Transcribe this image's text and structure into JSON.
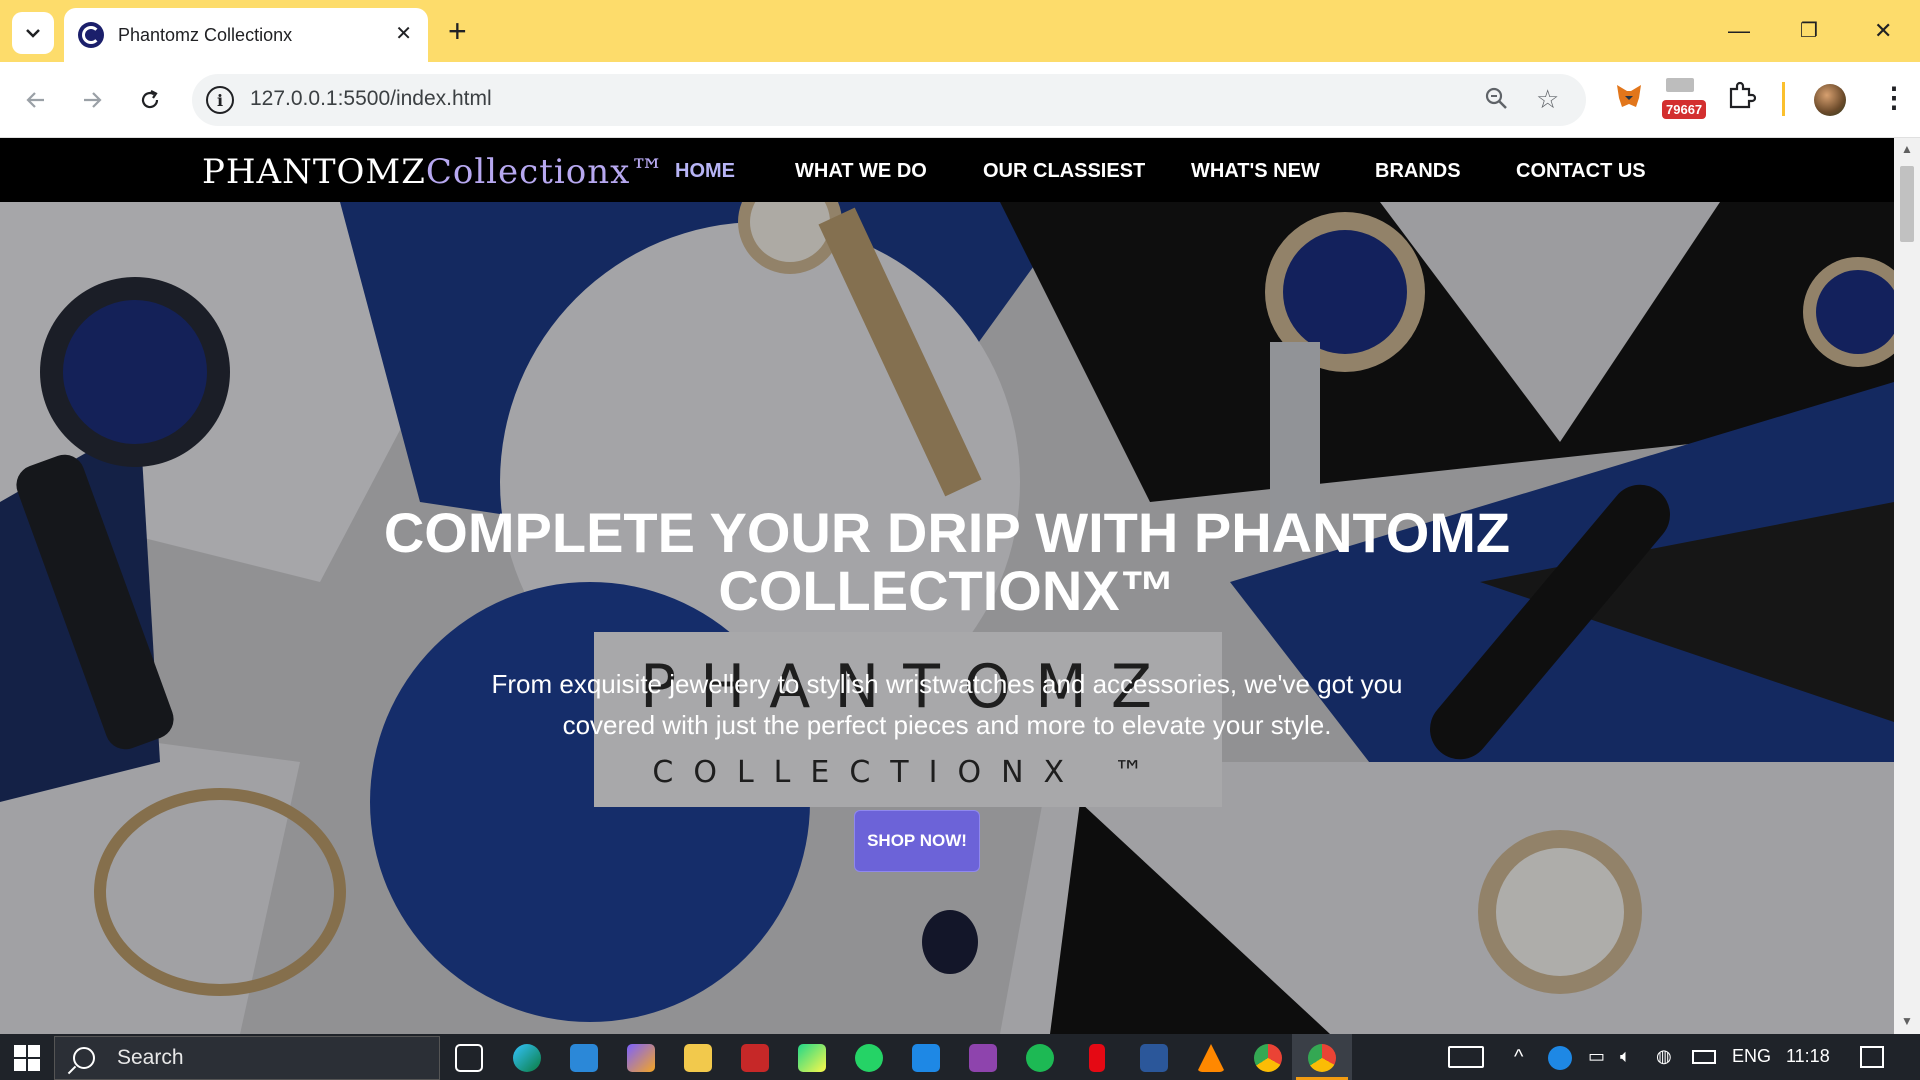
{
  "browser": {
    "tab_title": "Phantomz Collectionx",
    "url": "127.0.0.1:5500/index.html",
    "extension_badge": "79667"
  },
  "site": {
    "logo_part1": "PHANTOMZ",
    "logo_part2": "Collectionx™",
    "nav": [
      "HOME",
      "WHAT WE DO",
      "OUR CLASSIEST",
      "WHAT'S NEW",
      "BRANDS",
      "CONTACT US"
    ],
    "hero": {
      "title": "COMPLETE YOUR DRIP WITH PHANTOMZ COLLECTIONX™",
      "subtitle": "From exquisite jewellery to stylish wristwatches and accessories, we've got you covered with just the perfect pieces and more to elevate your style.",
      "cta": "SHOP NOW!",
      "background_brand_text_1": "PHANTOMZ",
      "background_brand_text_2": "COLLECTIONX ™"
    }
  },
  "taskbar": {
    "search_placeholder": "Search",
    "language": "ENG",
    "time": "11:18"
  },
  "colors": {
    "tabstrip": "#fddc6b",
    "nav_active": "#b7b4f5",
    "cta": "#6c63d8"
  }
}
